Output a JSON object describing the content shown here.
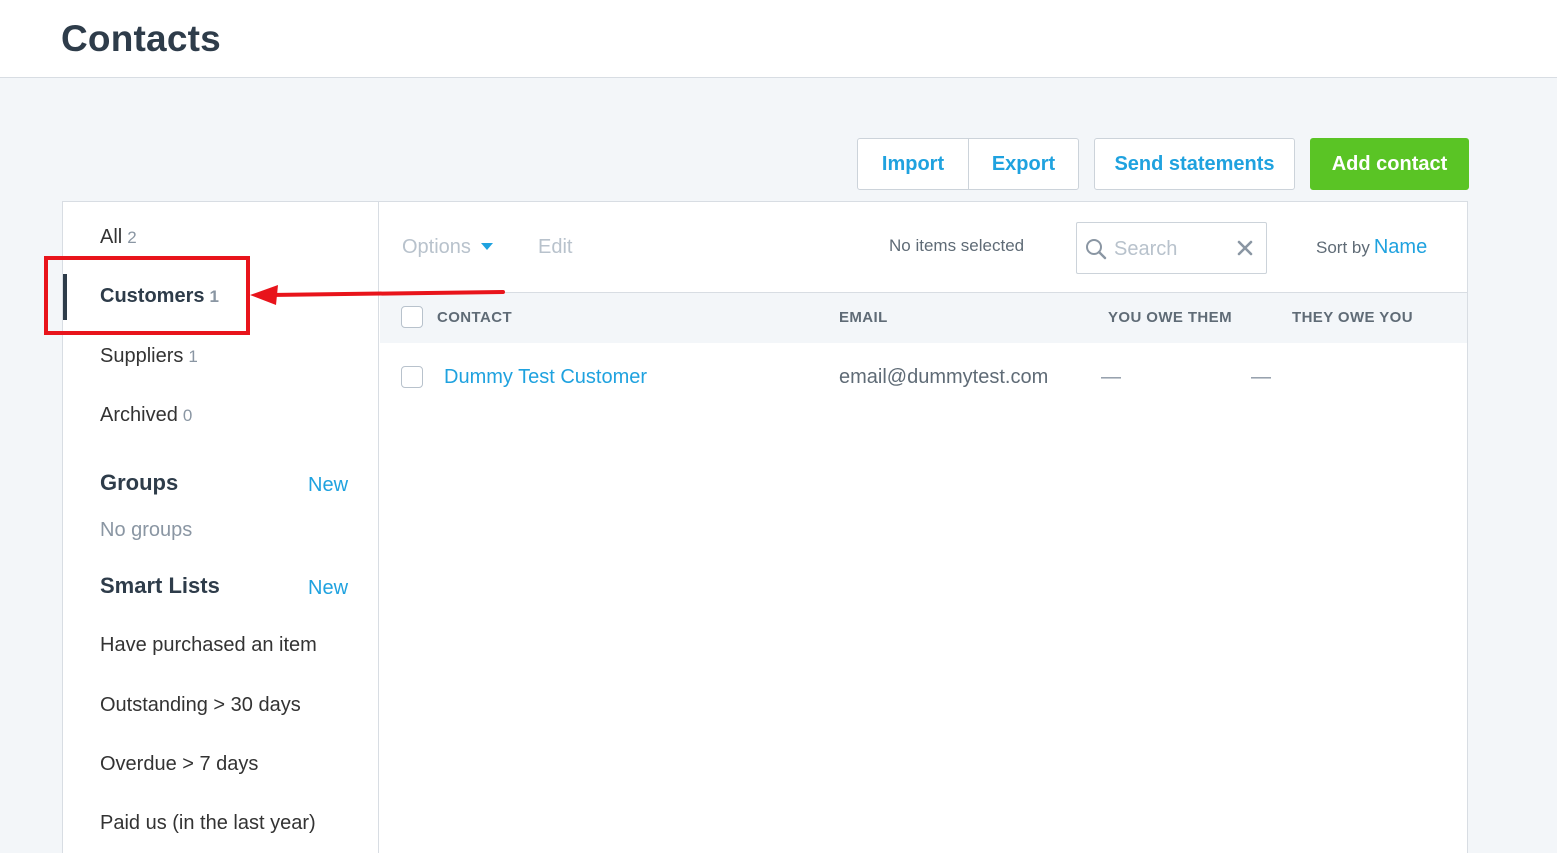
{
  "header": {
    "title": "Contacts"
  },
  "actions": {
    "import": "Import",
    "export": "Export",
    "send_statements": "Send statements",
    "add_contact": "Add contact"
  },
  "sidebar": {
    "filters": [
      {
        "label": "All",
        "count": "2"
      },
      {
        "label": "Customers",
        "count": "1"
      },
      {
        "label": "Suppliers",
        "count": "1"
      },
      {
        "label": "Archived",
        "count": "0"
      }
    ],
    "groups": {
      "title": "Groups",
      "new_label": "New",
      "empty_text": "No groups"
    },
    "smart_lists": {
      "title": "Smart Lists",
      "new_label": "New",
      "items": [
        "Have purchased an item",
        "Outstanding > 30 days",
        "Overdue > 7 days",
        "Paid us (in the last year)"
      ]
    }
  },
  "toolbar": {
    "options": "Options",
    "edit": "Edit",
    "status": "No items selected",
    "search_placeholder": "Search",
    "sort_label": "Sort by",
    "sort_value": "Name"
  },
  "table": {
    "columns": [
      "CONTACT",
      "EMAIL",
      "YOU OWE THEM",
      "THEY OWE YOU"
    ],
    "rows": [
      {
        "contact": "Dummy Test Customer",
        "email": "email@dummytest.com",
        "you_owe": "—",
        "they_owe": "—"
      }
    ]
  },
  "colors": {
    "accent": "#1fa2df",
    "add_button": "#5ac425",
    "annotation": "#e8141b"
  }
}
